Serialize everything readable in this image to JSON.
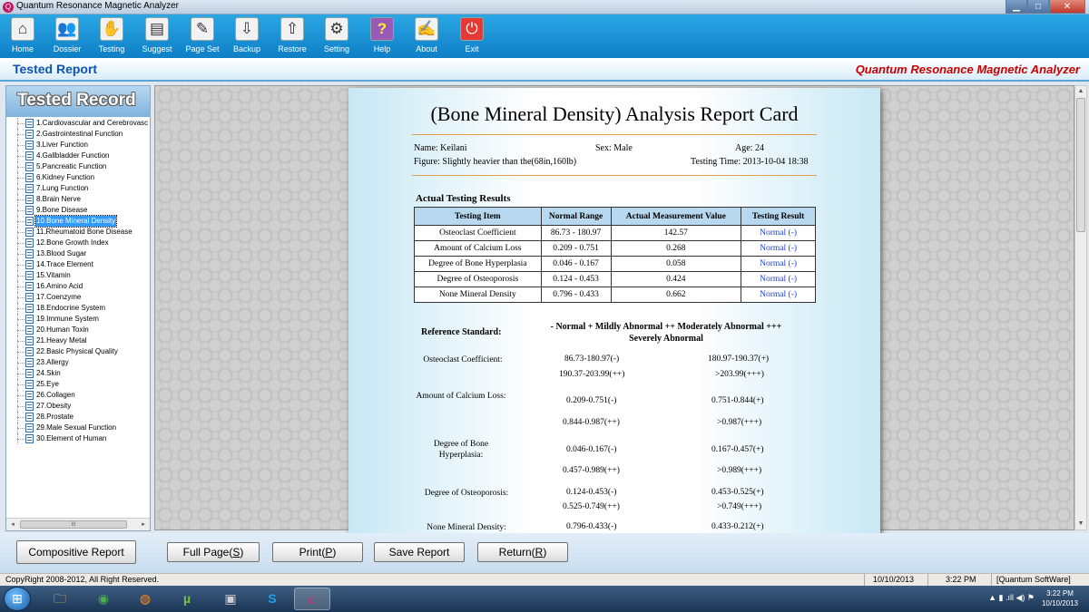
{
  "window": {
    "title": "Quantum Resonance Magnetic Analyzer",
    "min_glyph": "▁",
    "max_glyph": "□",
    "close_glyph": "✕"
  },
  "toolbar": {
    "items": [
      {
        "label": "Home",
        "icon": "home-icon",
        "glyph": "⌂"
      },
      {
        "label": "Dossier",
        "icon": "users-icon",
        "glyph": "👥"
      },
      {
        "label": "Testing",
        "icon": "hand-icon",
        "glyph": "✋"
      },
      {
        "label": "Suggest",
        "icon": "notes-icon",
        "glyph": "▤"
      },
      {
        "label": "Page Set",
        "icon": "page-setup-icon",
        "glyph": "✎"
      },
      {
        "label": "Backup",
        "icon": "backup-icon",
        "glyph": "⇩"
      },
      {
        "label": "Restore",
        "icon": "restore-icon",
        "glyph": "⇧"
      },
      {
        "label": "Setting",
        "icon": "gears-icon",
        "glyph": "⚙"
      },
      {
        "label": "Help",
        "icon": "help-icon",
        "glyph": "?"
      },
      {
        "label": "About",
        "icon": "about-icon",
        "glyph": "✍"
      },
      {
        "label": "Exit",
        "icon": "power-icon",
        "glyph": "⏻"
      }
    ]
  },
  "header": {
    "title": "Tested Report",
    "brand": "Quantum Resonance Magnetic Analyzer"
  },
  "sidebar": {
    "title": "Tested Record",
    "scroll_thumb_grip": "III",
    "scroll_left": "◂",
    "scroll_right": "▸",
    "items": [
      "1.Cardiovascular and Cerebrovasc",
      "2.Gastrointestinal Function",
      "3.Liver Function",
      "4.Gallbladder Function",
      "5.Pancreatic Function",
      "6.Kidney Function",
      "7.Lung Function",
      "8.Brain Nerve",
      "9.Bone Disease",
      "10.Bone Mineral Density",
      "11.Rheumatoid Bone Disease",
      "12.Bone Growth Index",
      "13.Blood Sugar",
      "14.Trace Element",
      "15.Vitamin",
      "16.Amino Acid",
      "17.Coenzyme",
      "18.Endocrine System",
      "19.Immune System",
      "20.Human Toxin",
      "21.Heavy Metal",
      "22.Basic Physical Quality",
      "23.Allergy",
      "24.Skin",
      "25.Eye",
      "26.Collagen",
      "27.Obesity",
      "28.Prostate",
      "29.Male Sexual Function",
      "30.Element of Human"
    ],
    "selected_index": 9
  },
  "report": {
    "title": "(Bone Mineral Density) Analysis Report Card",
    "name": "Name: Keilani",
    "sex": "Sex: Male",
    "age": "Age: 24",
    "figure": "Figure: Slightly heavier than the(68in,160lb)",
    "testing_time": "Testing Time: 2013-10-04 18:38",
    "results_title": "Actual Testing Results",
    "columns": [
      "Testing Item",
      "Normal Range",
      "Actual Measurement Value",
      "Testing Result"
    ],
    "rows": [
      {
        "item": "Osteoclast Coefficient",
        "range": "86.73 - 180.97",
        "value": "142.57",
        "result": "Normal (-)"
      },
      {
        "item": "Amount of Calcium Loss",
        "range": "0.209 - 0.751",
        "value": "0.268",
        "result": "Normal (-)"
      },
      {
        "item": "Degree of Bone Hyperplasia",
        "range": "0.046 - 0.167",
        "value": "0.058",
        "result": "Normal (-)"
      },
      {
        "item": "Degree of Osteoporosis",
        "range": "0.124 - 0.453",
        "value": "0.424",
        "result": "Normal (-)"
      },
      {
        "item": "None Mineral Density",
        "range": "0.796 - 0.433",
        "value": "0.662",
        "result": "Normal (-)"
      }
    ],
    "reference_title": "Reference Standard:",
    "legend_line1": "- Normal    + Mildly Abnormal    ++ Moderately Abnormal    +++",
    "legend_line2": "Severely Abnormal",
    "refs": [
      {
        "label": "Osteoclast Coefficient:",
        "a": "86.73-180.97(-)",
        "b": "180.97-190.37(+)",
        "c": "190.37-203.99(++)",
        "d": ">203.99(+++)"
      },
      {
        "label": "Amount of Calcium Loss:",
        "a": "0.209-0.751(-)",
        "b": "0.751-0.844(+)",
        "c": "0.844-0.987(++)",
        "d": ">0.987(+++)"
      },
      {
        "label": "Degree of Bone Hyperplasia:",
        "a": "0.046-0.167(-)",
        "b": "0.167-0.457(+)",
        "c": "0.457-0.989(++)",
        "d": ">0.989(+++)"
      },
      {
        "label": "Degree of Osteoporosis:",
        "a": "0.124-0.453(-)",
        "b": "0.453-0.525(+)",
        "c": "0.525-0.749(++)",
        "d": ">0.749(+++)"
      },
      {
        "label": "None Mineral Density:",
        "a": "0.796-0.433(-)",
        "b": "0.433-0.212(+)"
      }
    ]
  },
  "scroll": {
    "up": "▲",
    "down": "▼"
  },
  "buttons": {
    "compositive": "Compositive Report",
    "full_page": "Full Page(",
    "full_page_key": "S",
    "print": "Print(",
    "print_key": "P",
    "save": "Save Report",
    "return": "Return(",
    "return_key": "R",
    "close_paren": ")"
  },
  "status": {
    "copyright": "CopyRight 2008-2012, All Right Reserved.",
    "date": "10/10/2013",
    "time": "3:22 PM",
    "vendor": "[Quantum SoftWare]"
  },
  "taskbar": {
    "start_glyph": "⊞",
    "apps": [
      {
        "icon": "folder-icon",
        "glyph": "🗀",
        "color": "#f0c84a"
      },
      {
        "icon": "chrome-icon",
        "glyph": "◉",
        "color": "#4caf50"
      },
      {
        "icon": "firefox-icon",
        "glyph": "◍",
        "color": "#ff8a1d"
      },
      {
        "icon": "utorrent-icon",
        "glyph": "µ",
        "color": "#78c043"
      },
      {
        "icon": "terminal-icon",
        "glyph": "▣",
        "color": "#d0d0d0"
      },
      {
        "icon": "skype-icon",
        "glyph": "S",
        "color": "#1aa3e8"
      },
      {
        "icon": "analyzer-app-icon",
        "glyph": "☺",
        "color": "#e0287a"
      }
    ],
    "tray": "▲  ▮  .ıll  ◀)  ⚑",
    "clock_time": "3:22 PM",
    "clock_date": "10/10/2013"
  }
}
